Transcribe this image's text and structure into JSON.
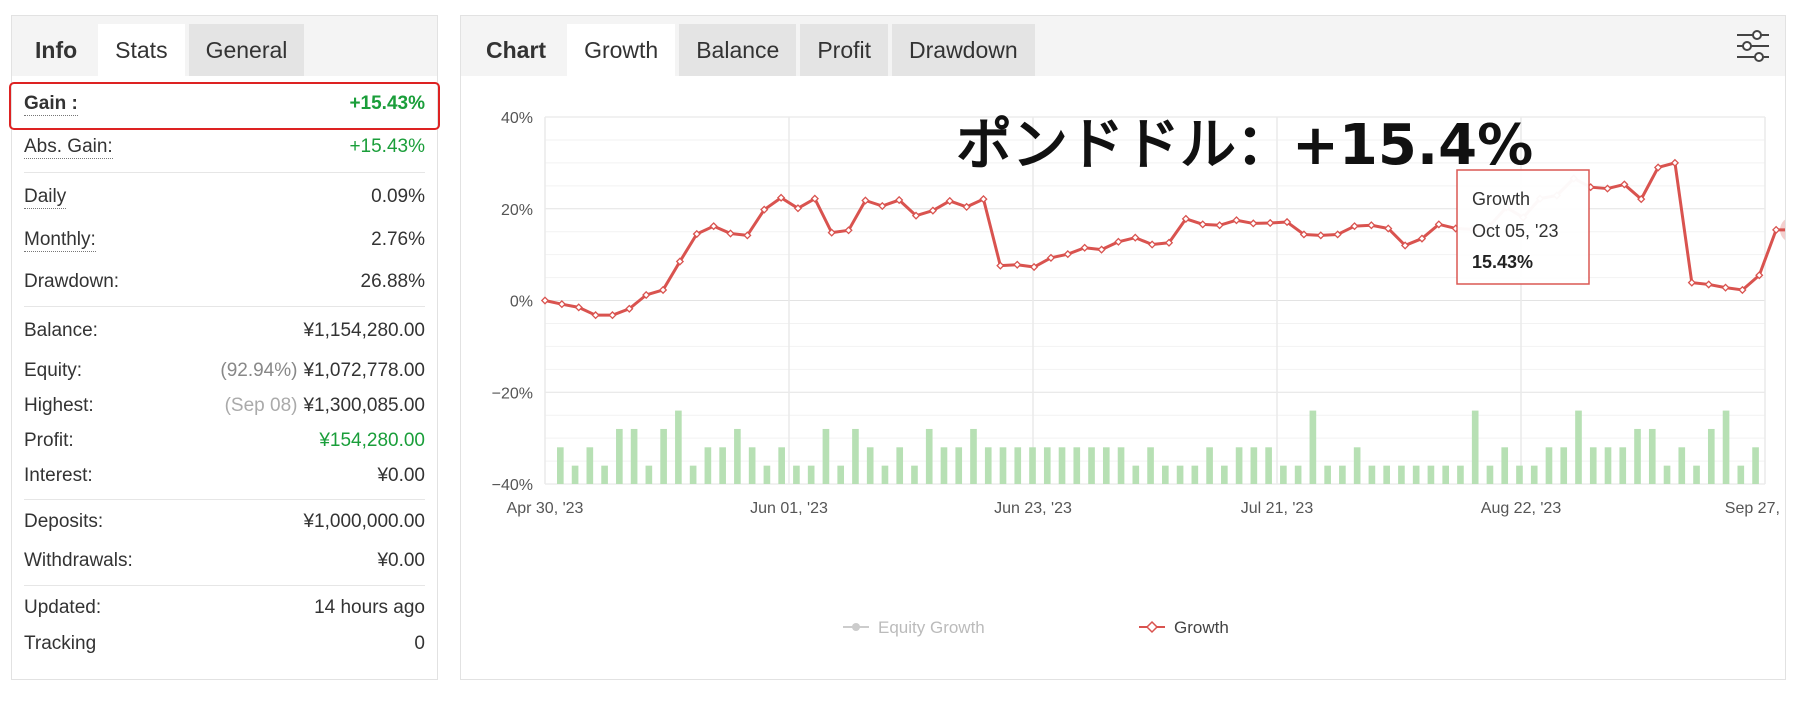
{
  "left": {
    "tabs": [
      {
        "label": "Info"
      },
      {
        "label": "Stats"
      },
      {
        "label": "General"
      }
    ],
    "gain": {
      "label": "Gain :",
      "value": "+15.43%"
    },
    "abs_gain": {
      "label": "Abs. Gain:",
      "value": "+15.43%"
    },
    "daily": {
      "label": "Daily",
      "value": "0.09%"
    },
    "monthly": {
      "label": "Monthly:",
      "value": "2.76%"
    },
    "drawdown": {
      "label": "Drawdown:",
      "value": "26.88%"
    },
    "balance": {
      "label": "Balance:",
      "value": "¥1,154,280.00"
    },
    "equity": {
      "label": "Equity:",
      "pct": "(92.94%)",
      "value": "¥1,072,778.00"
    },
    "highest": {
      "label": "Highest:",
      "date": "(Sep 08)",
      "value": "¥1,300,085.00"
    },
    "profit": {
      "label": "Profit:",
      "value": "¥154,280.00"
    },
    "interest": {
      "label": "Interest:",
      "value": "¥0.00"
    },
    "deposits": {
      "label": "Deposits:",
      "value": "¥1,000,000.00"
    },
    "withdrawals": {
      "label": "Withdrawals:",
      "value": "¥0.00"
    },
    "updated": {
      "label": "Updated:",
      "value": "14 hours ago"
    },
    "tracking": {
      "label": "Tracking",
      "value": "0"
    }
  },
  "right": {
    "tabs": [
      {
        "label": "Chart"
      },
      {
        "label": "Growth"
      },
      {
        "label": "Balance"
      },
      {
        "label": "Profit"
      },
      {
        "label": "Drawdown"
      }
    ]
  },
  "overlay_text": "ポンドドル：+15.4%",
  "tooltip": {
    "title": "Growth",
    "date": "Oct 05, '23",
    "value": "15.43%"
  },
  "colors": {
    "growth": "#d9534f",
    "bars": "#b7e0b4",
    "positive": "#1a9e3a",
    "highlight": "#dd2222"
  },
  "chart_data": {
    "type": "line",
    "title": "",
    "ylim": [
      -40,
      40
    ],
    "y_ticks": [
      "40%",
      "20%",
      "0%",
      "−20%",
      "−40%"
    ],
    "x_ticks": [
      "Apr 30, '23",
      "Jun 01, '23",
      "Jun 23, '23",
      "Jul 21, '23",
      "Aug 22, '23",
      "Sep 27, '23"
    ],
    "legend": [
      {
        "name": "Equity Growth",
        "enabled": false
      },
      {
        "name": "Growth",
        "enabled": true
      }
    ],
    "series": [
      {
        "name": "Growth",
        "values": [
          0,
          -0.8,
          -1.5,
          -3.2,
          -3.2,
          -1.8,
          1.2,
          2.3,
          8.5,
          14.5,
          16.2,
          14.6,
          14.2,
          19.8,
          22.4,
          20.1,
          22.2,
          14.8,
          15.3,
          21.8,
          20.6,
          21.9,
          18.5,
          19.6,
          21.7,
          20.4,
          22.1,
          7.6,
          7.8,
          7.3,
          9.3,
          10.1,
          11.5,
          11.1,
          12.8,
          13.7,
          12.2,
          12.6,
          17.8,
          16.6,
          16.4,
          17.5,
          16.8,
          16.9,
          17.1,
          14.4,
          14.2,
          14.4,
          16.2,
          16.4,
          15.7,
          12.0,
          13.5,
          16.6,
          15.7,
          15.5,
          16.2,
          20.3,
          18.1,
          22.2,
          22.9,
          26.6,
          24.7,
          24.4,
          25.3,
          22.1,
          29.0,
          30.0,
          3.9,
          3.5,
          2.8,
          2.3,
          5.5,
          15.4,
          15.4
        ]
      }
    ],
    "bars": [
      {
        "name": "Trades",
        "values": [
          8,
          4,
          8,
          4,
          12,
          12,
          4,
          12,
          16,
          4,
          8,
          8,
          12,
          8,
          4,
          8,
          4,
          4,
          12,
          4,
          12,
          8,
          4,
          8,
          4,
          12,
          8,
          8,
          12,
          8,
          8,
          8,
          8,
          8,
          8,
          8,
          8,
          8,
          8,
          4,
          8,
          4,
          4,
          4,
          8,
          4,
          8,
          8,
          8,
          4,
          4,
          16,
          4,
          4,
          8,
          4,
          4,
          4,
          4,
          4,
          4,
          4,
          16,
          4,
          8,
          4,
          4,
          8,
          8,
          16,
          8,
          8,
          8,
          12,
          12,
          4,
          8,
          4,
          12,
          16,
          4,
          8
        ]
      }
    ]
  }
}
